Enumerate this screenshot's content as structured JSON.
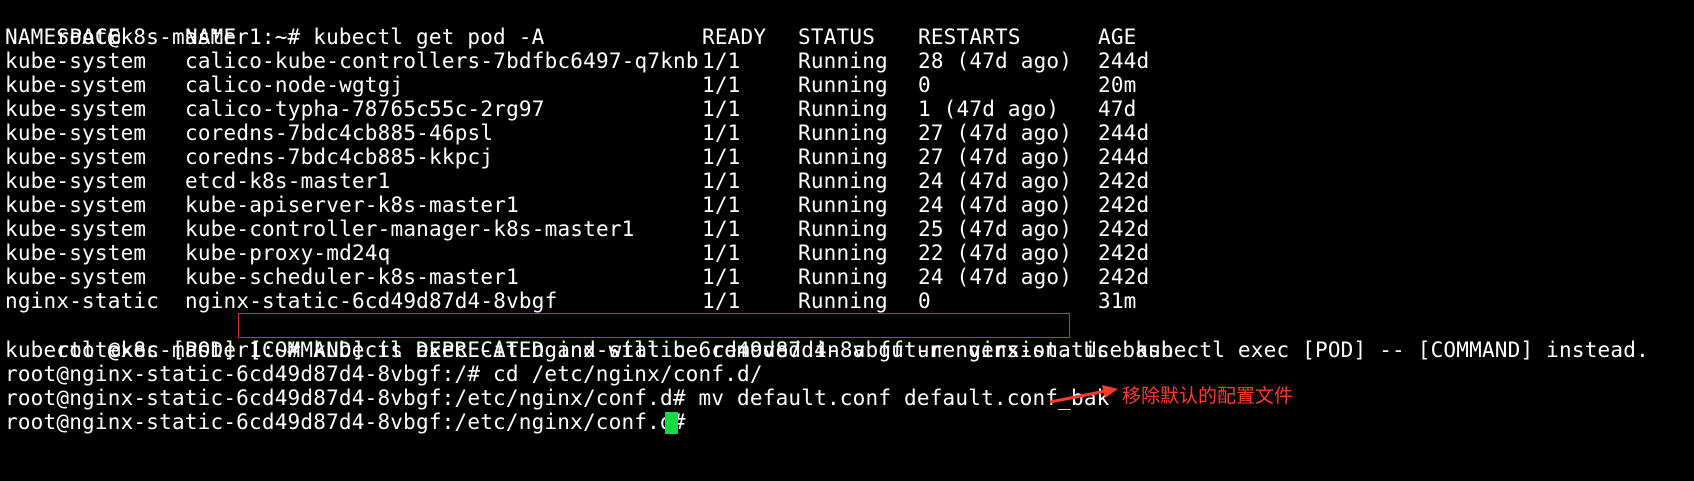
{
  "terminal": {
    "prompt_host": "root@k8s-master1:~#",
    "first_command": "kubectl get pod -A",
    "table": {
      "headers": [
        "NAMESPACE",
        "NAME",
        "READY",
        "STATUS",
        "RESTARTS",
        "AGE"
      ],
      "rows": [
        [
          "kube-system",
          "calico-kube-controllers-7bdfbc6497-q7knb",
          "1/1",
          "Running",
          "28 (47d ago)",
          "244d"
        ],
        [
          "kube-system",
          "calico-node-wgtgj",
          "1/1",
          "Running",
          "0",
          "20m"
        ],
        [
          "kube-system",
          "calico-typha-78765c55c-2rg97",
          "1/1",
          "Running",
          "1 (47d ago)",
          "47d"
        ],
        [
          "kube-system",
          "coredns-7bdc4cb885-46psl",
          "1/1",
          "Running",
          "27 (47d ago)",
          "244d"
        ],
        [
          "kube-system",
          "coredns-7bdc4cb885-kkpcj",
          "1/1",
          "Running",
          "27 (47d ago)",
          "244d"
        ],
        [
          "kube-system",
          "etcd-k8s-master1",
          "1/1",
          "Running",
          "24 (47d ago)",
          "242d"
        ],
        [
          "kube-system",
          "kube-apiserver-k8s-master1",
          "1/1",
          "Running",
          "24 (47d ago)",
          "242d"
        ],
        [
          "kube-system",
          "kube-controller-manager-k8s-master1",
          "1/1",
          "Running",
          "25 (47d ago)",
          "242d"
        ],
        [
          "kube-system",
          "kube-proxy-md24q",
          "1/1",
          "Running",
          "22 (47d ago)",
          "242d"
        ],
        [
          "kube-system",
          "kube-scheduler-k8s-master1",
          "1/1",
          "Running",
          "24 (47d ago)",
          "242d"
        ],
        [
          "nginx-static",
          "nginx-static-6cd49d87d4-8vbgf",
          "1/1",
          "Running",
          "0",
          "31m"
        ]
      ]
    },
    "second_command": "kubectl exec -it nginx-static-6cd49d87d4-8vbgf -n nginx-static bash",
    "deprecation_warning": "kubectl exec [POD] [COMMAND] is DEPRECATED and will be removed in a future version. Use kubectl exec [POD] -- [COMMAND] instead.",
    "line_cd": "root@nginx-static-6cd49d87d4-8vbgf:/# cd /etc/nginx/conf.d/",
    "line_mv": "root@nginx-static-6cd49d87d4-8vbgf:/etc/nginx/conf.d# mv default.conf default.conf_bak",
    "line_prompt": "root@nginx-static-6cd49d87d4-8vbgf:/etc/nginx/conf.d# ",
    "annotation": "移除默认的配置文件",
    "colors": {
      "background": "#000000",
      "text": "#ffffff",
      "highlight_box": "#e0292b",
      "annotation": "#ff3b30",
      "cursor": "#19d64a"
    }
  }
}
